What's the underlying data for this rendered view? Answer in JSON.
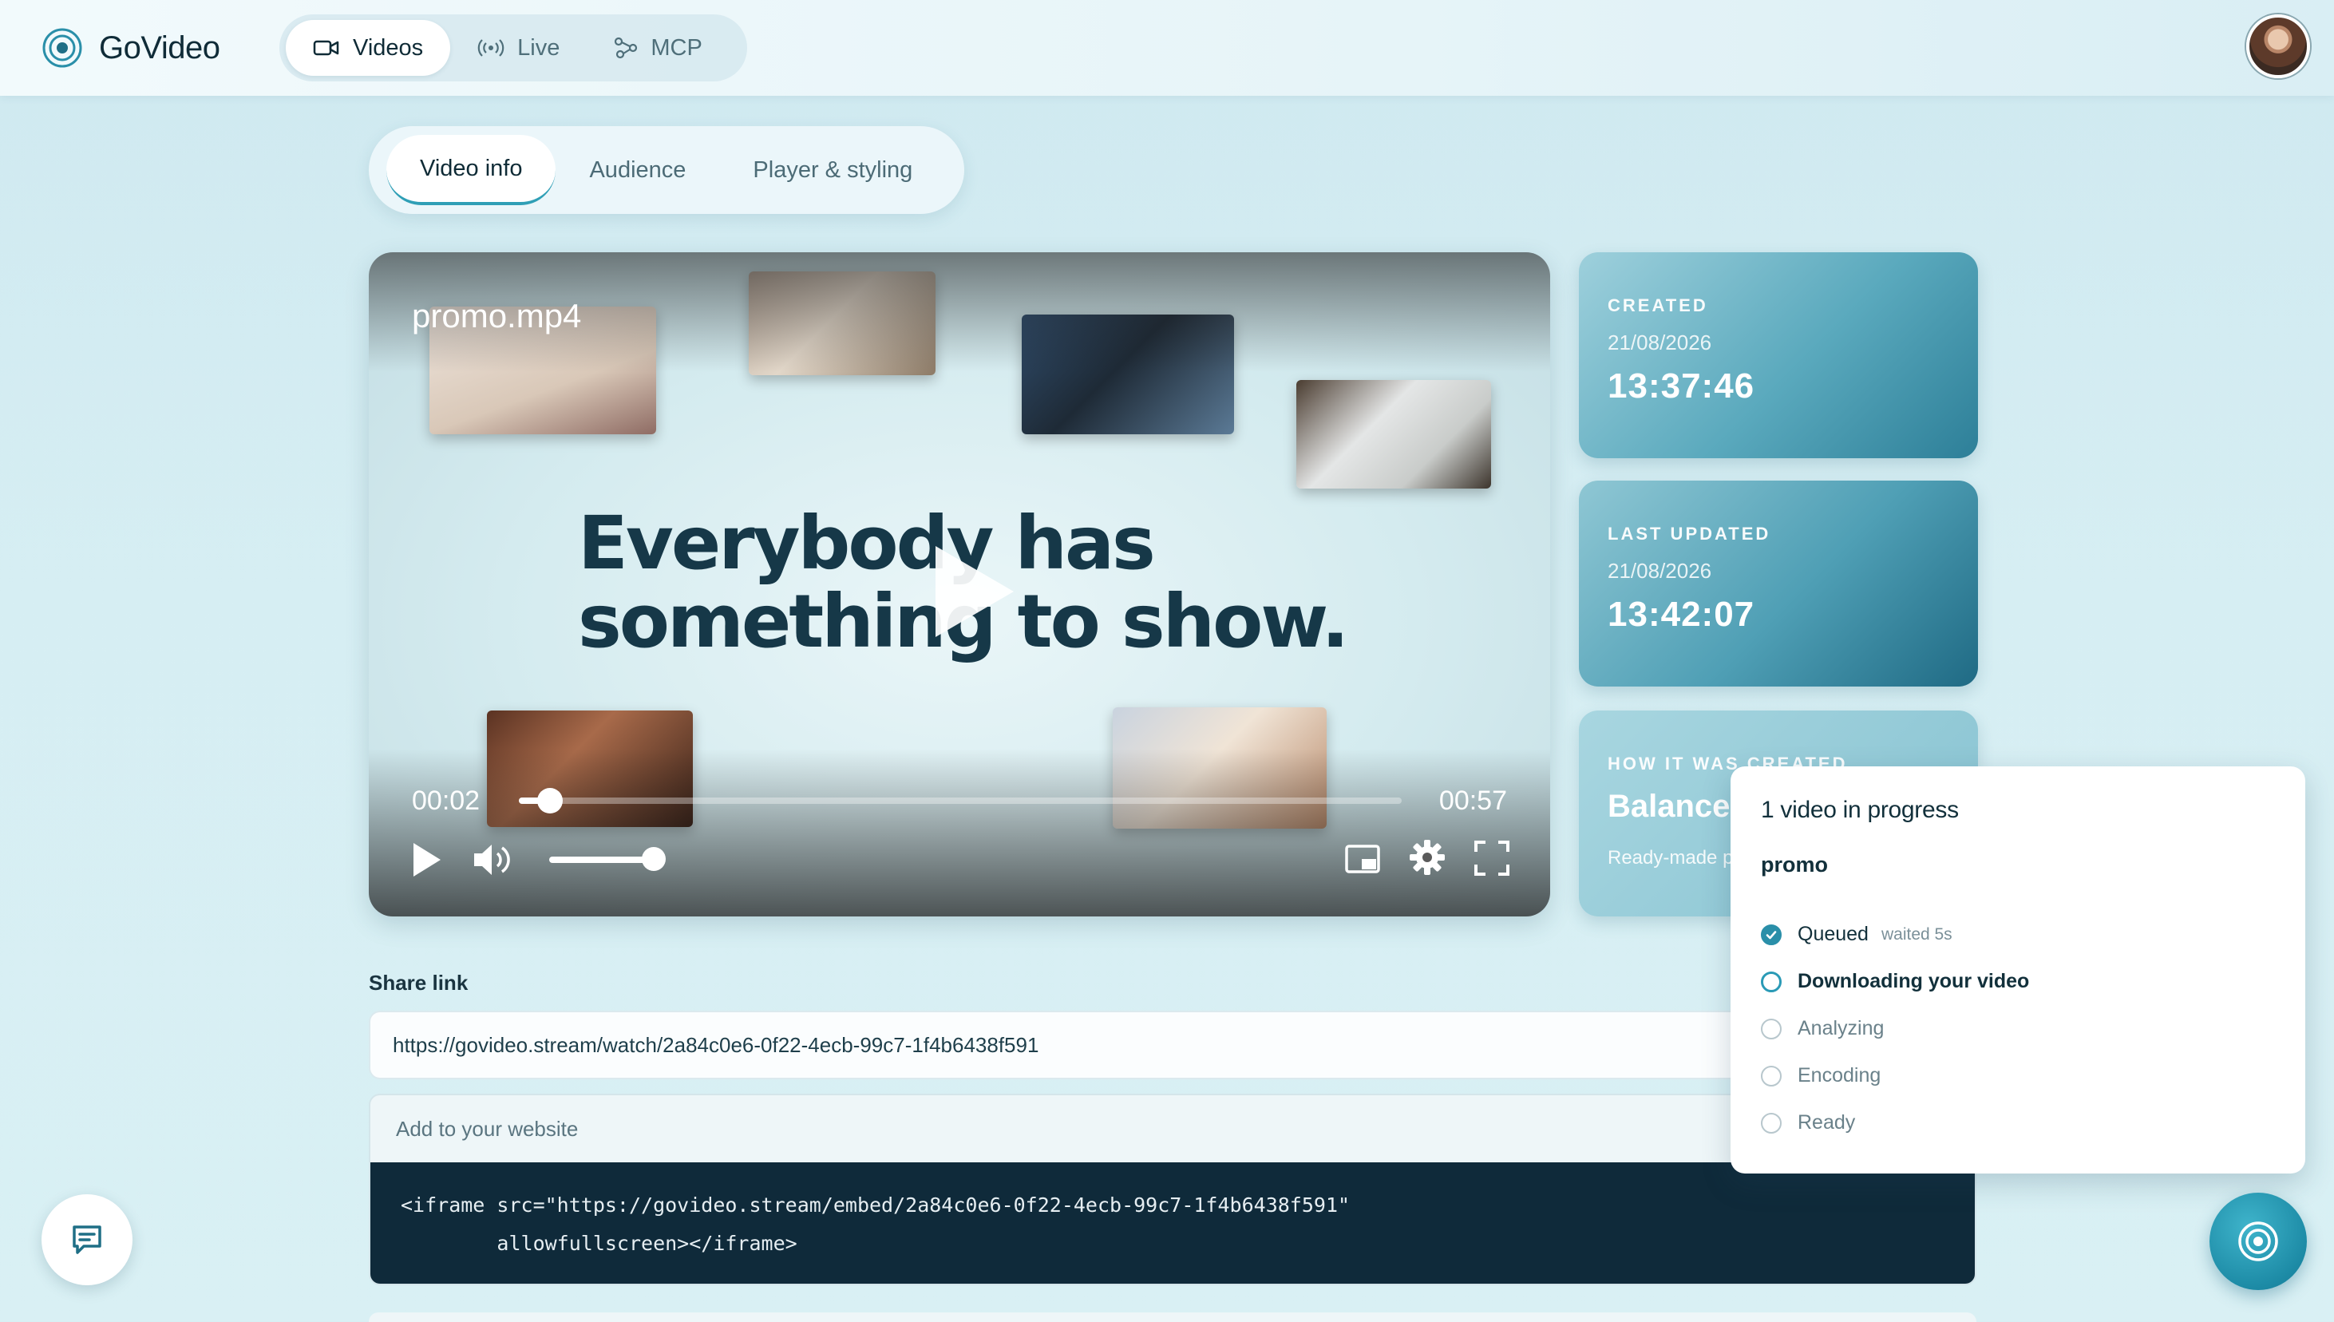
{
  "app": {
    "name": "GoVideo"
  },
  "nav": {
    "items": [
      {
        "label": "Videos",
        "icon": "video-camera-icon",
        "active": true
      },
      {
        "label": "Live",
        "icon": "broadcast-icon",
        "active": false
      },
      {
        "label": "MCP",
        "icon": "nodes-icon",
        "active": false
      }
    ]
  },
  "tabs": [
    {
      "label": "Video info",
      "active": true
    },
    {
      "label": "Audience",
      "active": false
    },
    {
      "label": "Player & styling",
      "active": false
    }
  ],
  "player": {
    "filename": "promo.mp4",
    "headline_line1": "Everybody has",
    "headline_line2": "something to show.",
    "current_time": "00:02",
    "duration": "00:57",
    "progress_fraction": 0.035,
    "volume_fraction": 0.85
  },
  "cards": {
    "created": {
      "label": "CREATED",
      "date": "21/08/2026",
      "time": "13:37:46"
    },
    "updated": {
      "label": "LAST UPDATED",
      "date": "21/08/2026",
      "time": "13:42:07"
    },
    "how": {
      "label": "HOW IT WAS CREATED",
      "value": "Balance",
      "sub": "Ready-made p"
    }
  },
  "share": {
    "label": "Share link",
    "url": "https://govideo.stream/watch/2a84c0e6-0f22-4ecb-99c7-1f4b6438f591",
    "embed_title": "Add to your website",
    "embed_code": "<iframe src=\"https://govideo.stream/embed/2a84c0e6-0f22-4ecb-99c7-1f4b6438f591\"\n        allowfullscreen></iframe>"
  },
  "progress_popover": {
    "title": "1 video in progress",
    "video_name": "promo",
    "steps": [
      {
        "label": "Queued",
        "note": "waited 5s",
        "state": "done"
      },
      {
        "label": "Downloading your video",
        "note": "",
        "state": "current"
      },
      {
        "label": "Analyzing",
        "note": "",
        "state": "pending"
      },
      {
        "label": "Encoding",
        "note": "",
        "state": "pending"
      },
      {
        "label": "Ready",
        "note": "",
        "state": "pending"
      }
    ]
  },
  "colors": {
    "accent": "#2a8fa9",
    "code_bg": "#0f2a3a",
    "card_gradient_end": "#2d7f98"
  }
}
